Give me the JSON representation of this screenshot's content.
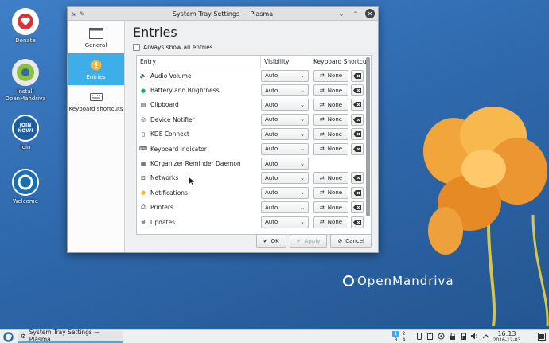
{
  "desktop": {
    "icons": [
      {
        "label": "Donate"
      },
      {
        "label": "Install OpenMandriva"
      },
      {
        "label": "Join"
      },
      {
        "label": "Welcome"
      }
    ],
    "join_badge": "JOIN NOW!",
    "brand": "OpenMandriva"
  },
  "window": {
    "title": "System Tray Settings — Plasma",
    "sidebar": [
      {
        "label": "General"
      },
      {
        "label": "Entries"
      },
      {
        "label": "Keyboard shortcuts"
      }
    ],
    "heading": "Entries",
    "always_show": "Always show all entries",
    "columns": [
      "Entry",
      "Visibility",
      "Keyboard Shortcut"
    ],
    "rows": [
      {
        "entry": "Audio Volume",
        "visibility": "Auto",
        "shortcut": "None"
      },
      {
        "entry": "Battery and Brightness",
        "visibility": "Auto",
        "shortcut": "None"
      },
      {
        "entry": "Clipboard",
        "visibility": "Auto",
        "shortcut": "None"
      },
      {
        "entry": "Device Notifier",
        "visibility": "Auto",
        "shortcut": "None"
      },
      {
        "entry": "KDE Connect",
        "visibility": "Auto",
        "shortcut": "None"
      },
      {
        "entry": "Keyboard Indicator",
        "visibility": "Auto",
        "shortcut": "None"
      },
      {
        "entry": "KOrganizer Reminder Daemon",
        "visibility": "Auto",
        "shortcut": ""
      },
      {
        "entry": "Networks",
        "visibility": "Auto",
        "shortcut": "None"
      },
      {
        "entry": "Notifications",
        "visibility": "Auto",
        "shortcut": "None"
      },
      {
        "entry": "Printers",
        "visibility": "Auto",
        "shortcut": "None"
      },
      {
        "entry": "Updates",
        "visibility": "Auto",
        "shortcut": "None"
      }
    ],
    "buttons": {
      "ok": "OK",
      "apply": "Apply",
      "cancel": "Cancel"
    }
  },
  "taskbar": {
    "task_label": "System Tray Settings — Plasma",
    "pager": [
      "1",
      "2",
      "3",
      "4"
    ],
    "time": "16:13",
    "date": "2016-12-03"
  },
  "colors": {
    "accent": "#3daee9",
    "panel": "#eff0f1"
  }
}
